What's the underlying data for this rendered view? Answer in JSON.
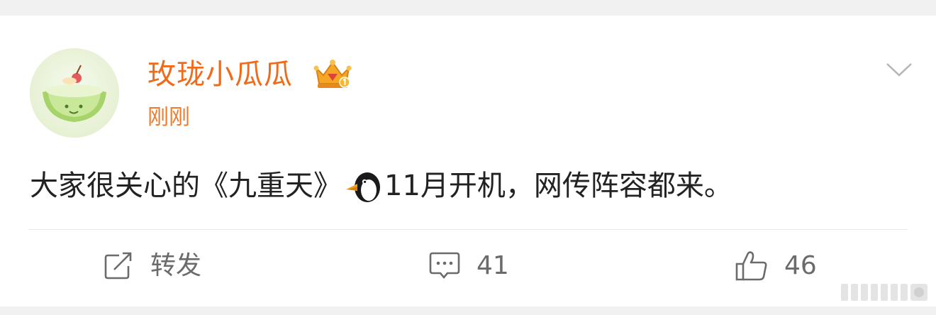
{
  "post": {
    "author": "玫珑小瓜瓜",
    "time": "刚刚",
    "text_before": "大家很关心的《九重天》",
    "text_after": "11月开机，网传阵容都来。",
    "emoji": "penguin-emoji"
  },
  "actions": {
    "repost_label": "转发",
    "comment_count": "41",
    "like_count": "46"
  },
  "colors": {
    "author": "#f06a1a",
    "time": "#f07a2a",
    "text": "#222222",
    "action": "#6b6b6b"
  },
  "icons": [
    "avatar-melon",
    "crown-badge-icon",
    "chevron-down-icon",
    "repost-icon",
    "comment-icon",
    "like-icon",
    "watermark-icon"
  ]
}
